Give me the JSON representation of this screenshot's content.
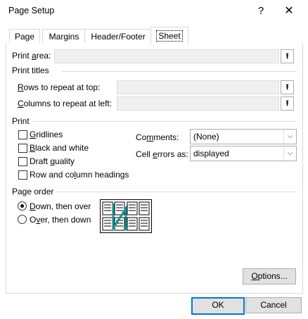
{
  "window": {
    "title": "Page Setup",
    "help_label": "?",
    "close_label": "✕"
  },
  "tabs": [
    {
      "label": "Page"
    },
    {
      "label": "Margins"
    },
    {
      "label": "Header/Footer"
    },
    {
      "label": "Sheet"
    }
  ],
  "active_tab": "Sheet",
  "print_area": {
    "label_pre": "Print ",
    "label_u": "a",
    "label_post": "rea:",
    "value": ""
  },
  "print_titles": {
    "heading": "Print titles",
    "rows_label_u": "R",
    "rows_label_post": "ows to repeat at top:",
    "rows_value": "",
    "cols_label_u": "C",
    "cols_label_post": "olumns to repeat at left:",
    "cols_value": ""
  },
  "print": {
    "heading": "Print",
    "gridlines_u": "G",
    "gridlines_post": "ridlines",
    "gridlines_checked": false,
    "bw_u": "B",
    "bw_post": "lack and white",
    "bw_checked": false,
    "draft_pre": "Draft ",
    "draft_u": "q",
    "draft_post": "uality",
    "draft_checked": false,
    "headings_pre": "Row and co",
    "headings_u": "l",
    "headings_post": "umn headings",
    "headings_checked": false,
    "comments_pre": "Co",
    "comments_u": "m",
    "comments_post": "ments:",
    "comments_value": "(None)",
    "errors_pre": "Cell ",
    "errors_u": "e",
    "errors_post": "rrors as:",
    "errors_value": "displayed"
  },
  "page_order": {
    "heading": "Page order",
    "down_u": "D",
    "down_post": "own, then over",
    "down_selected": true,
    "over_pre": "O",
    "over_u": "v",
    "over_post": "er, then down",
    "over_selected": false
  },
  "buttons": {
    "options_u": "O",
    "options_post": "ptions...",
    "ok": "OK",
    "cancel": "Cancel"
  },
  "icons": {
    "ref": "collapse-dialog-icon",
    "dropdown": "chevron-down-icon"
  }
}
